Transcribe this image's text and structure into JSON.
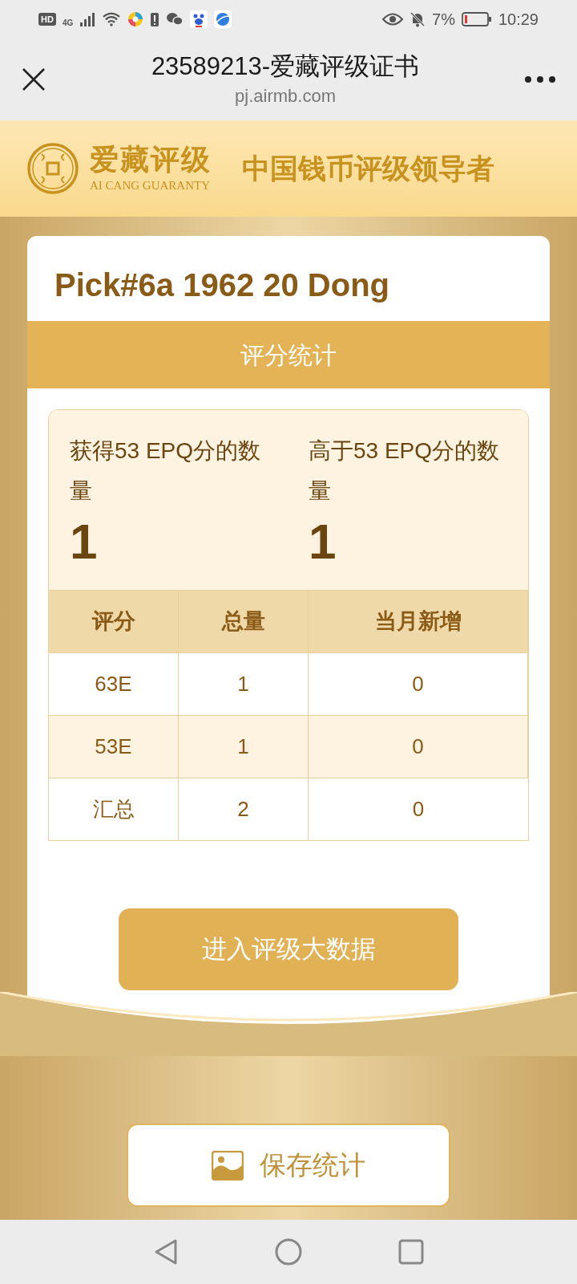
{
  "status_bar": {
    "hd": "HD",
    "network": "4G",
    "battery": "7%",
    "time": "10:29"
  },
  "browser": {
    "title": "23589213-爱藏评级证书",
    "url": "pj.airmb.com"
  },
  "banner": {
    "brand": "爱藏评级",
    "brand_en": "AI CANG GUARANTY",
    "slogan": "中国钱币评级领导者"
  },
  "card": {
    "title": "Pick#6a 1962 20 Dong",
    "section": "评分统计",
    "stats": [
      {
        "label": "获得53 EPQ分的数量",
        "value": "1"
      },
      {
        "label": "高于53 EPQ分的数量",
        "value": "1"
      }
    ],
    "table": {
      "columns": [
        "评分",
        "总量",
        "当月新增"
      ],
      "rows": [
        [
          "63E",
          "1",
          "0"
        ],
        [
          "53E",
          "1",
          "0"
        ],
        [
          "汇总",
          "2",
          "0"
        ]
      ]
    },
    "button": "进入评级大数据"
  },
  "save_button": "保存统计"
}
